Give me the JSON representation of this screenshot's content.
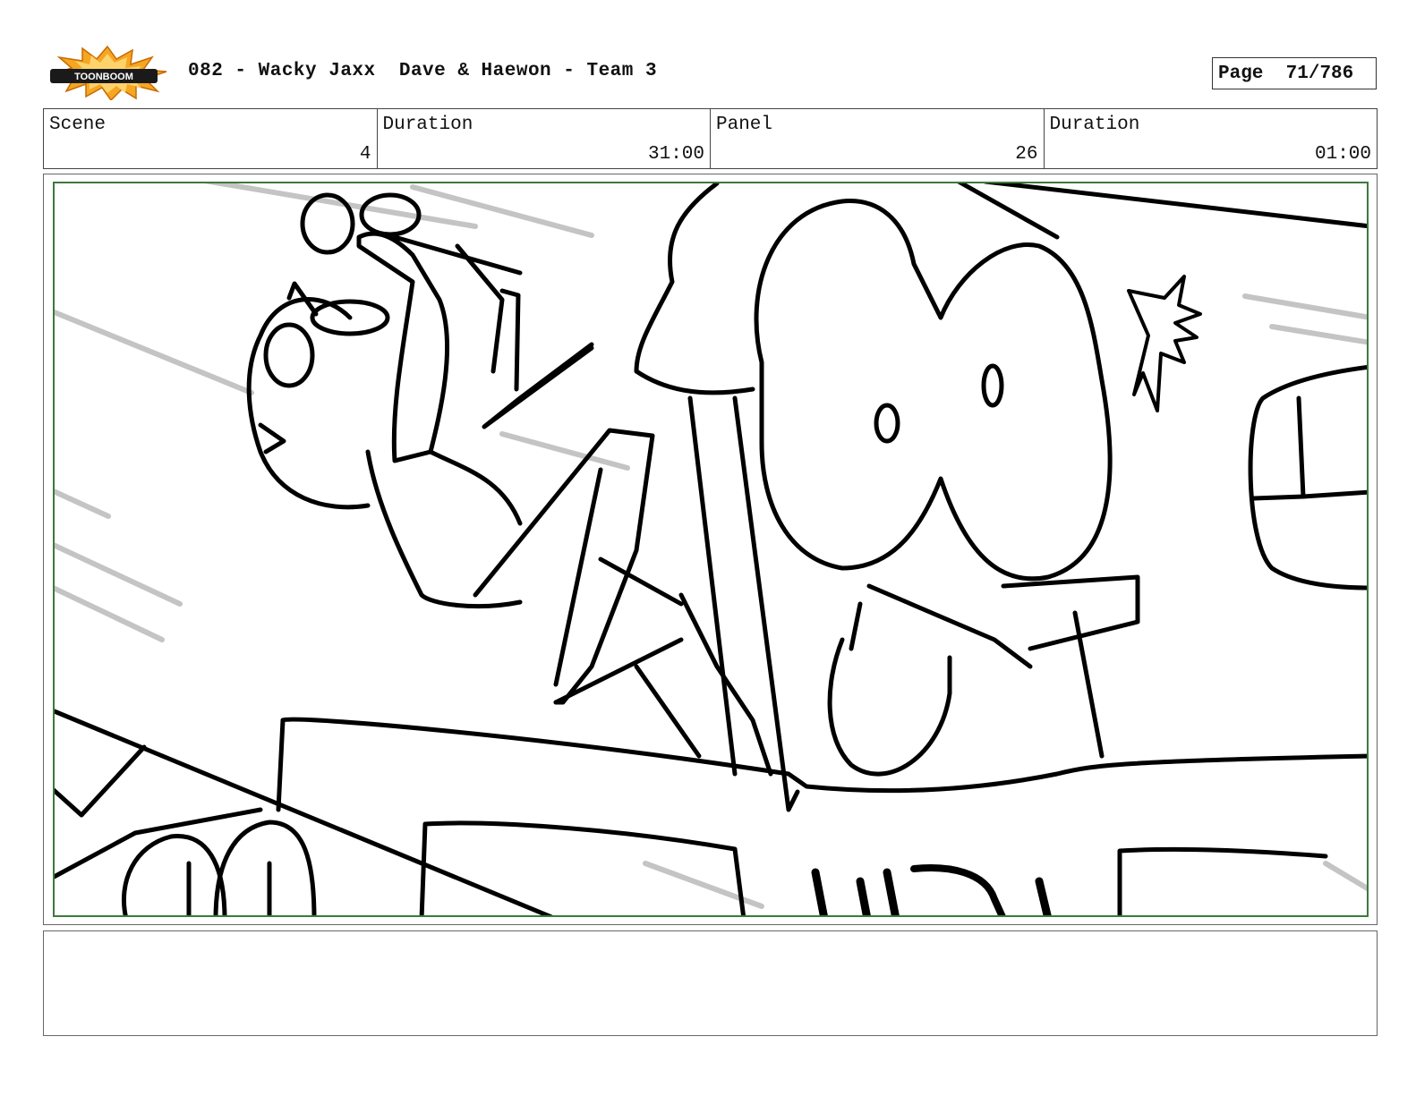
{
  "header": {
    "logo_text": "TOONBOOM",
    "title": "082 - Wacky Jaxx  Dave & Haewon - Team 3",
    "page_label": "Page",
    "page_value": "71/786"
  },
  "info": {
    "scene_label": "Scene",
    "scene_value": "4",
    "scene_duration_label": "Duration",
    "scene_duration_value": "31:00",
    "panel_label": "Panel",
    "panel_value": "26",
    "panel_duration_label": "Duration",
    "panel_duration_value": "01:00"
  },
  "colors": {
    "panel_border": "#3c7a3c",
    "logo_burst": "#f5a623",
    "sketch_line": "#000000",
    "motion_line": "#c4c4c4"
  }
}
